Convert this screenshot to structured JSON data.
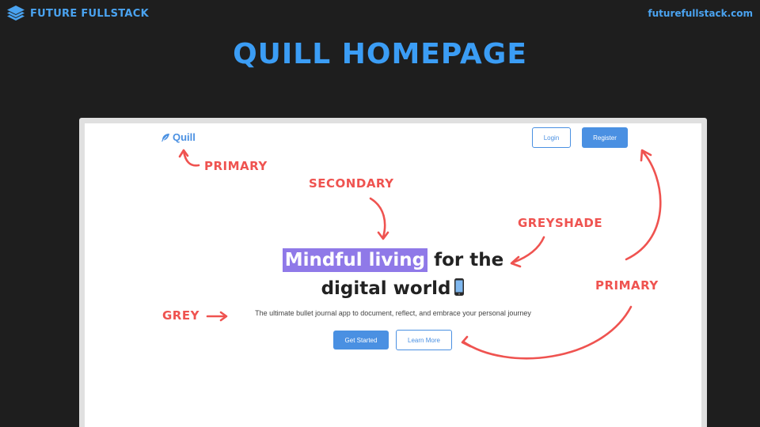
{
  "header": {
    "brand_name": "FUTURE FULLSTACK",
    "site_url": "futurefullstack.com",
    "logo_icon": "stacked-layers-icon"
  },
  "slide": {
    "title": "QUILL HOMEPAGE"
  },
  "quill_page": {
    "logo": {
      "text": "Quill",
      "icon": "feather-icon"
    },
    "nav": {
      "login_label": "Login",
      "register_label": "Register"
    },
    "hero": {
      "highlight": "Mindful living",
      "rest_line1": "for the",
      "line2": "digital world",
      "emoji_icon": "phone-icon"
    },
    "subtitle": "The ultimate bullet journal app to document, reflect, and embrace your personal journey",
    "cta": {
      "primary_label": "Get Started",
      "secondary_label": "Learn More"
    }
  },
  "annotations": {
    "primary_logo": "PRIMARY",
    "secondary": "SECONDARY",
    "greyshade": "GREYSHADE",
    "primary_buttons": "PRIMARY",
    "grey": "GREY"
  },
  "colors": {
    "background": "#1e1e1e",
    "brand_blue": "#4aa3f0",
    "title_blue": "#3b9df5",
    "primary": "#4a90e2",
    "secondary": "#8f79e8",
    "annotation_red": "#ef5350",
    "greyshade_text": "#222222",
    "grey_text": "#444444"
  }
}
